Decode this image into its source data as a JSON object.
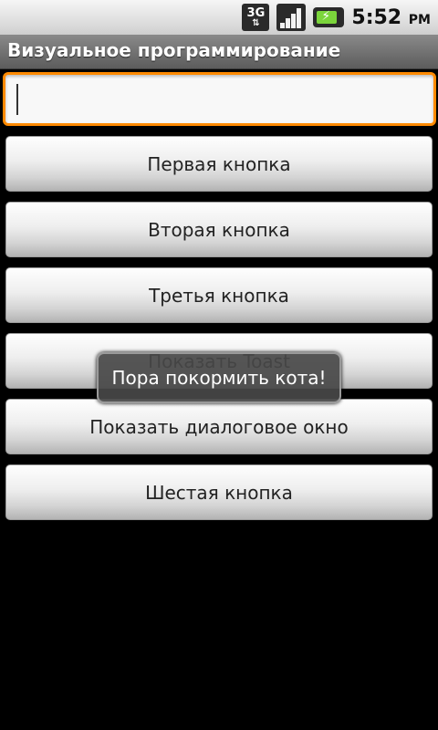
{
  "statusbar": {
    "network_label": "3G",
    "network_arrows": "⇅",
    "battery_bolt": "⚡",
    "time": "5:52",
    "ampm": "PM"
  },
  "app": {
    "title": "Визуальное программирование"
  },
  "edit": {
    "value": ""
  },
  "buttons": [
    {
      "label": "Первая кнопка"
    },
    {
      "label": "Вторая кнопка"
    },
    {
      "label": "Третья кнопка"
    },
    {
      "label": "Показать Toast"
    },
    {
      "label": "Показать диалоговое окно"
    },
    {
      "label": "Шестая кнопка"
    }
  ],
  "toast": {
    "text": "Пора покормить кота!"
  },
  "colors": {
    "focus_border": "#ff8a00",
    "battery_fill": "#7bd53b"
  }
}
